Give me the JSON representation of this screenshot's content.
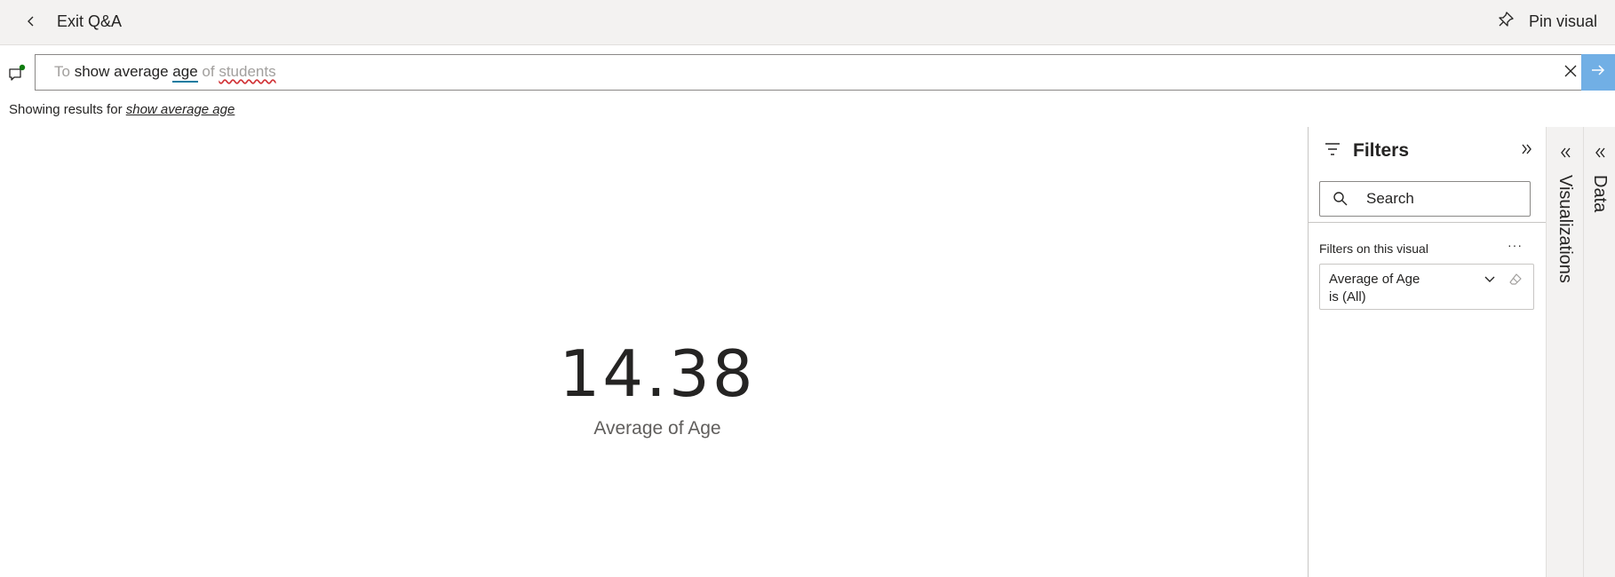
{
  "header": {
    "exit_label": "Exit Q&A",
    "pin_label": "Pin visual"
  },
  "qa": {
    "tokens": [
      {
        "text": "To",
        "style": "grey"
      },
      {
        "text": " ",
        "style": "grey"
      },
      {
        "text": "show average",
        "style": "dark"
      },
      {
        "text": " ",
        "style": "dark"
      },
      {
        "text": "age",
        "style": "blue"
      },
      {
        "text": " ",
        "style": "dark"
      },
      {
        "text": "of",
        "style": "grey"
      },
      {
        "text": " ",
        "style": "grey"
      },
      {
        "text": "students",
        "style": "red"
      }
    ],
    "results_prefix": "Showing results for",
    "results_query": "show average age"
  },
  "card": {
    "value": "14.38",
    "label": "Average of Age"
  },
  "filters": {
    "title": "Filters",
    "search_placeholder": "Search",
    "section_label": "Filters on this visual",
    "more_label": "···",
    "items": [
      {
        "line1": "Average of Age",
        "line2": "is (All)"
      }
    ]
  },
  "side_panes": {
    "visualizations": "Visualizations",
    "data": "Data"
  },
  "colors": {
    "accent": "#71afe5",
    "link_underline_blue": "#117ba0",
    "error_underline_red": "#d13438",
    "status_dot_green": "#107c10"
  }
}
